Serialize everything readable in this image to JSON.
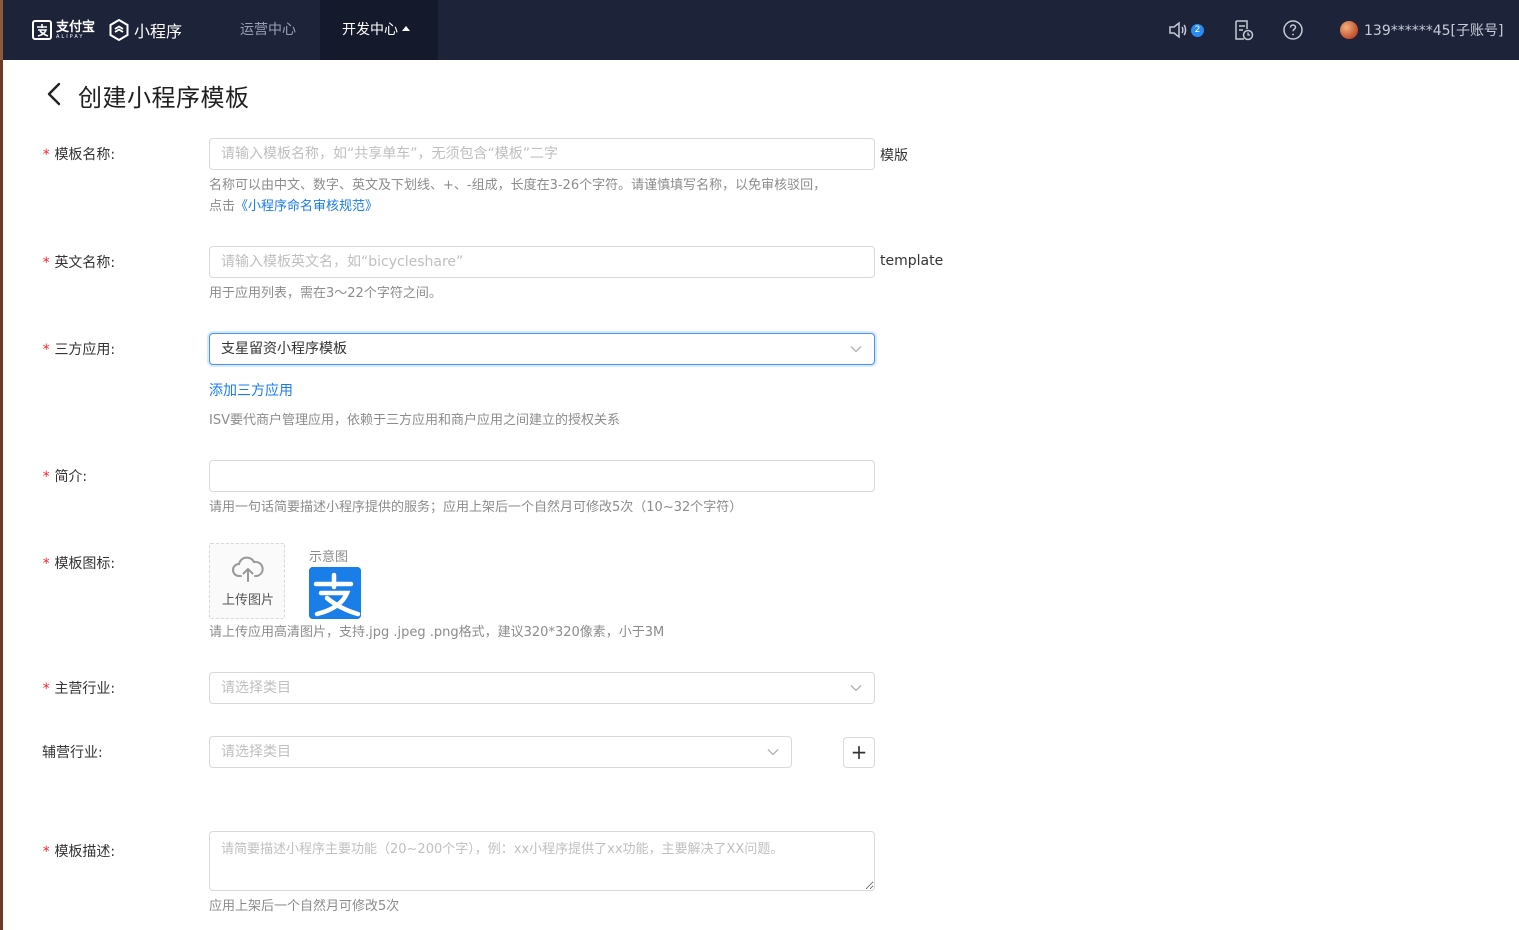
{
  "header": {
    "brand_cn": "支付宝",
    "brand_en": "ALIPAY",
    "product": "小程序",
    "nav": [
      {
        "label": "运营中心",
        "active": false
      },
      {
        "label": "开发中心",
        "active": true
      }
    ],
    "notification_count": "2",
    "user": "139******45[子账号]"
  },
  "page": {
    "title": "创建小程序模板"
  },
  "form": {
    "template_name": {
      "label": "模板名称:",
      "placeholder": "请输入模板名称，如“共享单车”，无须包含“模板”二字",
      "suffix": "模版",
      "help_line1": "名称可以由中文、数字、英文及下划线、+、-组成，长度在3-26个字符。请谨慎填写名称，以免审核驳回，",
      "help_prefix": "点击",
      "help_link": "《小程序命名审核规范》"
    },
    "english_name": {
      "label": "英文名称:",
      "placeholder": "请输入模板英文名，如“bicycleshare”",
      "suffix": "template",
      "help": "用于应用列表，需在3～22个字符之间。"
    },
    "third_party_app": {
      "label": "三方应用:",
      "value": "支星留资小程序模板",
      "add_link": "添加三方应用",
      "help": "ISV要代商户管理应用，依赖于三方应用和商户应用之间建立的授权关系"
    },
    "intro": {
      "label": "简介:",
      "value": "",
      "help": "请用一句话简要描述小程序提供的服务；应用上架后一个自然月可修改5次（10~32个字符）"
    },
    "icon": {
      "label": "模板图标:",
      "upload_label": "上传图片",
      "sample_label": "示意图",
      "help": "请上传应用高清图片，支持.jpg .jpeg .png格式，建议320*320像素，小于3M"
    },
    "main_industry": {
      "label": "主营行业:",
      "placeholder": "请选择类目"
    },
    "secondary_industry": {
      "label": "辅营行业:",
      "placeholder": "请选择类目",
      "add_symbol": "+"
    },
    "description": {
      "label": "模板描述:",
      "placeholder": "请简要描述小程序主要功能（20~200个字），例：xx小程序提供了xx功能，主要解决了XX问题。",
      "help": "应用上架后一个自然月可修改5次"
    },
    "required_mark": "*"
  },
  "colors": {
    "header_bg": "#1d2338",
    "active_nav_bg": "#141a2c",
    "link": "#1a7cf0",
    "required": "#f5222d",
    "focus_border": "#4c8ff7",
    "alipay_blue": "#1a7ee8"
  },
  "icons": [
    "alipay-logo-icon",
    "miniprogram-logo-icon",
    "volume-icon",
    "document-clock-icon",
    "help-circle-icon",
    "back-arrow-icon",
    "chevron-down-icon",
    "cloud-upload-icon",
    "plus-icon"
  ]
}
